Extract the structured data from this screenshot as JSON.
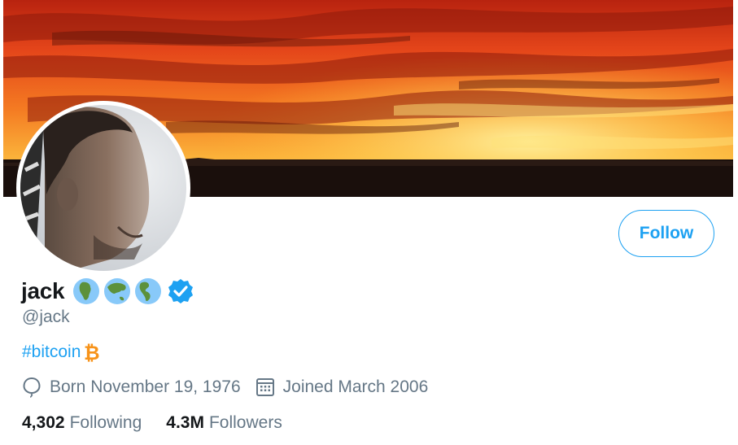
{
  "profile": {
    "display_name": "jack",
    "handle": "@jack",
    "bio_hashtag": "#bitcoin",
    "born": "Born November 19, 1976",
    "joined": "Joined March 2006"
  },
  "actions": {
    "follow_label": "Follow"
  },
  "stats": {
    "following_count": "4,302",
    "following_label": "Following",
    "followers_count": "4.3M",
    "followers_label": "Followers"
  },
  "icons": [
    "globe-africa-icon",
    "globe-asia-icon",
    "globe-americas-icon",
    "verified-badge-icon",
    "bitcoin-icon",
    "balloon-icon",
    "calendar-icon"
  ],
  "colors": {
    "accent": "#1da1f2",
    "muted": "#657786",
    "text": "#14171a",
    "bitcoin": "#f7931a"
  }
}
